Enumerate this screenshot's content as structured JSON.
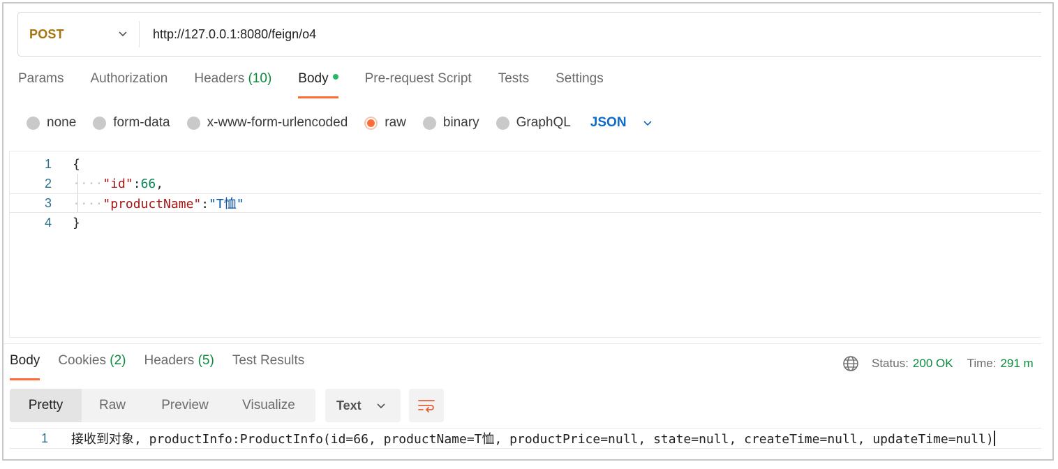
{
  "request": {
    "method": "POST",
    "url": "http://127.0.0.1:8080/feign/o4"
  },
  "request_tabs": [
    {
      "label": "Params"
    },
    {
      "label": "Authorization"
    },
    {
      "label": "Headers",
      "count": "(10)"
    },
    {
      "label": "Body",
      "active": true
    },
    {
      "label": "Pre-request Script"
    },
    {
      "label": "Tests"
    },
    {
      "label": "Settings"
    }
  ],
  "body_modes": {
    "options": [
      "none",
      "form-data",
      "x-www-form-urlencoded",
      "raw",
      "binary",
      "GraphQL"
    ],
    "selected": "raw",
    "language": "JSON"
  },
  "editor": {
    "lines": [
      {
        "num": "1",
        "text": "{"
      },
      {
        "num": "2",
        "key": "\"id\"",
        "sep": ":",
        "value": "66",
        "trail": ","
      },
      {
        "num": "3",
        "key": "\"productName\"",
        "sep": ":",
        "value": "\"T恤\"",
        "trail": ""
      },
      {
        "num": "4",
        "text": "}"
      }
    ]
  },
  "response_tabs": [
    {
      "label": "Body",
      "active": true
    },
    {
      "label": "Cookies",
      "count": "(2)"
    },
    {
      "label": "Headers",
      "count": "(5)"
    },
    {
      "label": "Test Results"
    }
  ],
  "response_meta": {
    "status_label": "Status:",
    "status_value": "200 OK",
    "time_label": "Time:",
    "time_value": "291 m"
  },
  "view_modes": [
    "Pretty",
    "Raw",
    "Preview",
    "Visualize"
  ],
  "format": "Text",
  "response_body": {
    "num": "1",
    "text": "接收到对象, productInfo:ProductInfo(id=66, productName=T恤, productPrice=null, state=null, createTime=null, updateTime=null)"
  },
  "colors": {
    "accent": "#ff6c37",
    "method": "#a6740d",
    "success": "#0b8a3c",
    "link": "#0f6bc9"
  },
  "icons": {
    "method_dropdown": "chevron-down-icon",
    "language_dropdown": "chevron-down-icon",
    "network": "globe-icon",
    "wrap": "wrap-lines-icon"
  }
}
